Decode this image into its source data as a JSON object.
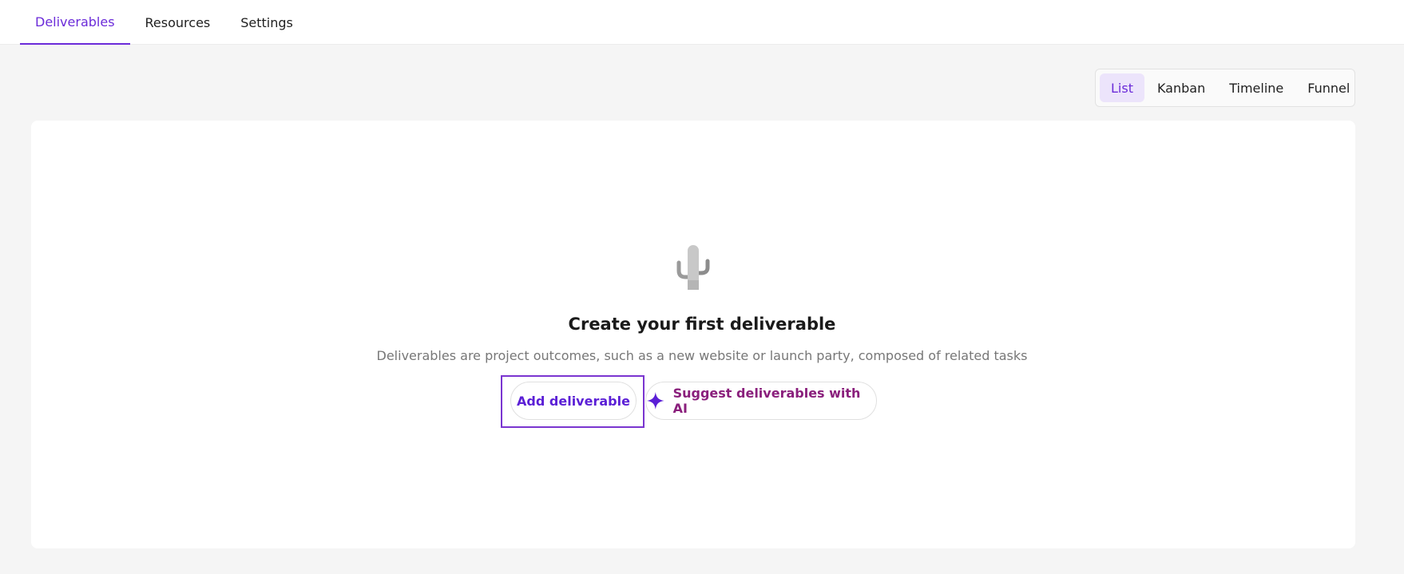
{
  "tabs": [
    {
      "label": "Deliverables"
    },
    {
      "label": "Resources"
    },
    {
      "label": "Settings"
    }
  ],
  "view_switch": {
    "options": [
      "List",
      "Kanban",
      "Timeline",
      "Funnel"
    ],
    "selected": "List"
  },
  "empty_state": {
    "icon": "cactus-icon",
    "title": "Create your first deliverable",
    "description": "Deliverables are project outcomes, such as a new website or launch party, composed of related tasks",
    "add_button_label": "Add deliverable",
    "ai_button_label": "Suggest deliverables with AI",
    "ai_icon": "sparkle-icon"
  },
  "colors": {
    "accent": "#6b2bd9",
    "ai_text": "#8a1f7c",
    "background": "#f5f5f5",
    "card": "#ffffff"
  }
}
